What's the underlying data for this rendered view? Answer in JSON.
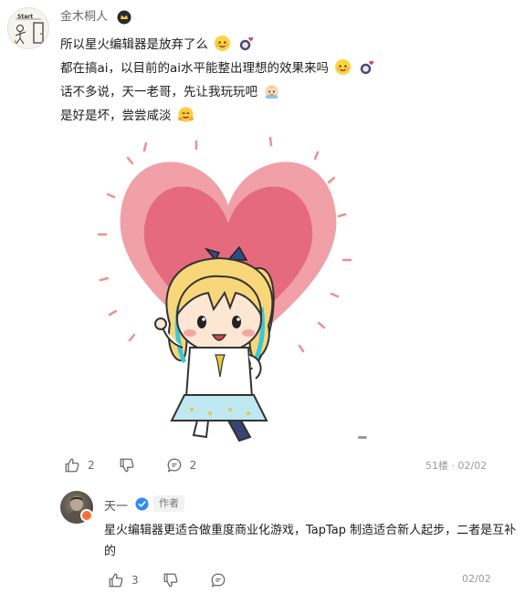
{
  "comment": {
    "author": "金木桐人",
    "lines": [
      "所以星火编辑器是放弃了么",
      "都在搞ai，以目前的ai水平能整出理想的效果来吗",
      "话不多说，天一老哥，先让我玩玩吧",
      "是好是坏，尝尝咸淡"
    ],
    "avatar_text": "Start",
    "likes": "2",
    "replies": "2",
    "floor": "51楼",
    "date": "02/02"
  },
  "reply": {
    "author": "天一",
    "role_tag": "作者",
    "text": "星火编辑器更适合做重度商业化游戏，TapTap 制造适合新人起步，二者是互补的",
    "likes": "3",
    "date": "02/02"
  },
  "icons": {
    "like": "thumbs-up-icon",
    "dislike": "thumbs-down-icon",
    "comment": "comment-bubble-icon",
    "verified": "verified-check-icon",
    "badge": "user-badge-icon"
  },
  "colors": {
    "heart_outer": "#f0a0a6",
    "heart_inner": "#e56a7e",
    "verified": "#2e8cf0",
    "accent_badge": "#ff6d3a"
  }
}
